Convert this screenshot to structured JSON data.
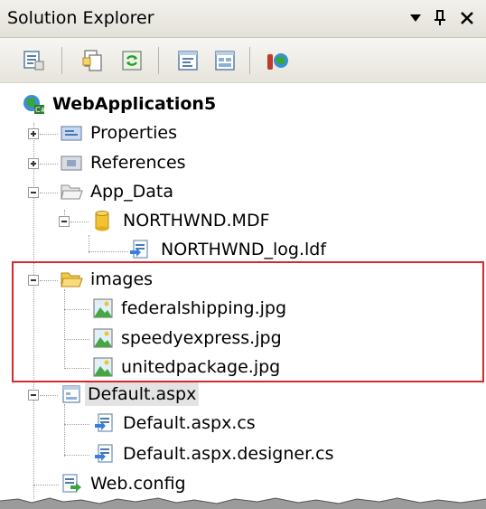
{
  "panel": {
    "title": "Solution Explorer",
    "dropdown_glyph": "▾",
    "pin_glyph": "ᵰ",
    "close_glyph": "✕"
  },
  "toolbar": {
    "buttons": [
      {
        "name": "properties-button-icon"
      },
      {
        "name": "show-all-files-icon"
      },
      {
        "name": "refresh-icon"
      },
      {
        "name": "view-code-icon"
      },
      {
        "name": "view-designer-icon"
      },
      {
        "name": "copy-website-icon"
      }
    ]
  },
  "tree": {
    "project": "WebApplication5",
    "properties": "Properties",
    "references": "References",
    "app_data": "App_Data",
    "northwnd_mdf": "NORTHWND.MDF",
    "northwnd_log": "NORTHWND_log.ldf",
    "images": "images",
    "img1": "federalshipping.jpg",
    "img2": "speedyexpress.jpg",
    "img3": "unitedpackage.jpg",
    "default_aspx": "Default.aspx",
    "default_cs": "Default.aspx.cs",
    "default_designer": "Default.aspx.designer.cs",
    "web_config": "Web.config"
  },
  "colors": {
    "highlight_border": "#d42a2a",
    "folder": "#f2c94c",
    "selected_bg": "#e3e3e3"
  }
}
